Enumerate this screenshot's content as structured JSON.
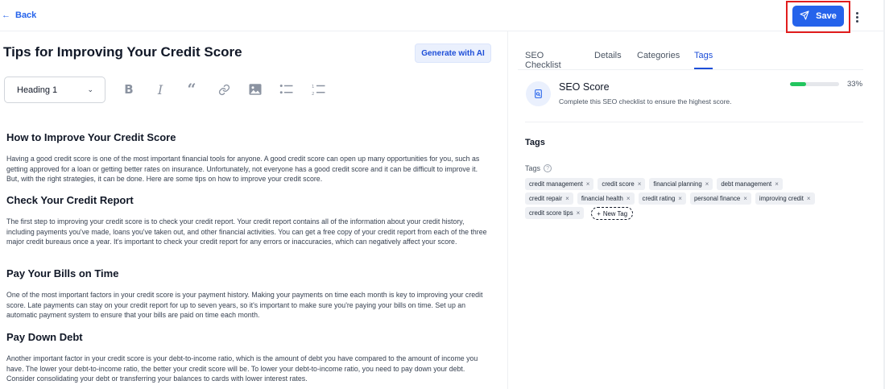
{
  "topbar": {
    "back_label": "Back",
    "back_icon": "arrow-left-icon",
    "save_label": "Save",
    "save_icon": "send-icon",
    "more_icon": "vertical-dots-icon"
  },
  "editor": {
    "title": "Tips for Improving Your Credit Score",
    "generate_ai_label": "Generate with AI",
    "heading_select_value": "Heading 1",
    "toolbar_icons": [
      "bold-icon",
      "italic-icon",
      "quote-icon",
      "link-icon",
      "image-icon",
      "bullet-list-icon",
      "numbered-list-icon"
    ],
    "toolbar_glyphs": {
      "bold": "B",
      "italic": "I",
      "quote": "“"
    },
    "sections": [
      {
        "heading": "How to Improve Your Credit Score",
        "body": "Having a good credit score is one of the most important financial tools for anyone. A good credit score can open up many opportunities for you, such as getting approved for a loan or getting better rates on insurance. Unfortunately, not everyone has a good credit score and it can be difficult to improve it. But, with the right strategies, it can be done. Here are some tips on how to improve your credit score."
      },
      {
        "heading": "Check Your Credit Report",
        "body": "The first step to improving your credit score is to check your credit report. Your credit report contains all of the information about your credit history, including payments you've made, loans you've taken out, and other financial activities. You can get a free copy of your credit report from each of the three major credit bureaus once a year. It's important to check your credit report for any errors or inaccuracies, which can negatively affect your score."
      },
      {
        "heading": "Pay Your Bills on Time",
        "body": "One of the most important factors in your credit score is your payment history. Making your payments on time each month is key to improving your credit score. Late payments can stay on your credit report for up to seven years, so it's important to make sure you're paying your bills on time. Set up an automatic payment system to ensure that your bills are paid on time each month."
      },
      {
        "heading": "Pay Down Debt",
        "body": "Another important factor in your credit score is your debt-to-income ratio, which is the amount of debt you have compared to the amount of income you have. The lower your debt-to-income ratio, the better your credit score will be. To lower your debt-to-income ratio, you need to pay down your debt. Consider consolidating your debt or transferring your balances to cards with lower interest rates."
      }
    ]
  },
  "panel": {
    "tabs": [
      "SEO Checklist",
      "Details",
      "Categories",
      "Tags"
    ],
    "active_tab": "Tags",
    "seo": {
      "title": "SEO Score",
      "subtitle": "Complete this SEO checklist to ensure the highest score.",
      "progress": 0.33,
      "percent_label": "33%",
      "icon": "seo-document-icon"
    },
    "tags_heading": "Tags",
    "tags_label": "Tags",
    "help_glyph": "?",
    "tags": [
      "credit management",
      "credit score",
      "financial planning",
      "debt management",
      "credit repair",
      "financial health",
      "credit rating",
      "personal finance",
      "improving credit",
      "credit score tips"
    ],
    "remove_glyph": "×",
    "new_tag_label": "New Tag",
    "new_tag_glyph": "+"
  },
  "colors": {
    "accent": "#2563eb",
    "highlight_frame": "#e11d1d",
    "progress": "#22c55e",
    "tag_bg": "#eef0f4"
  }
}
